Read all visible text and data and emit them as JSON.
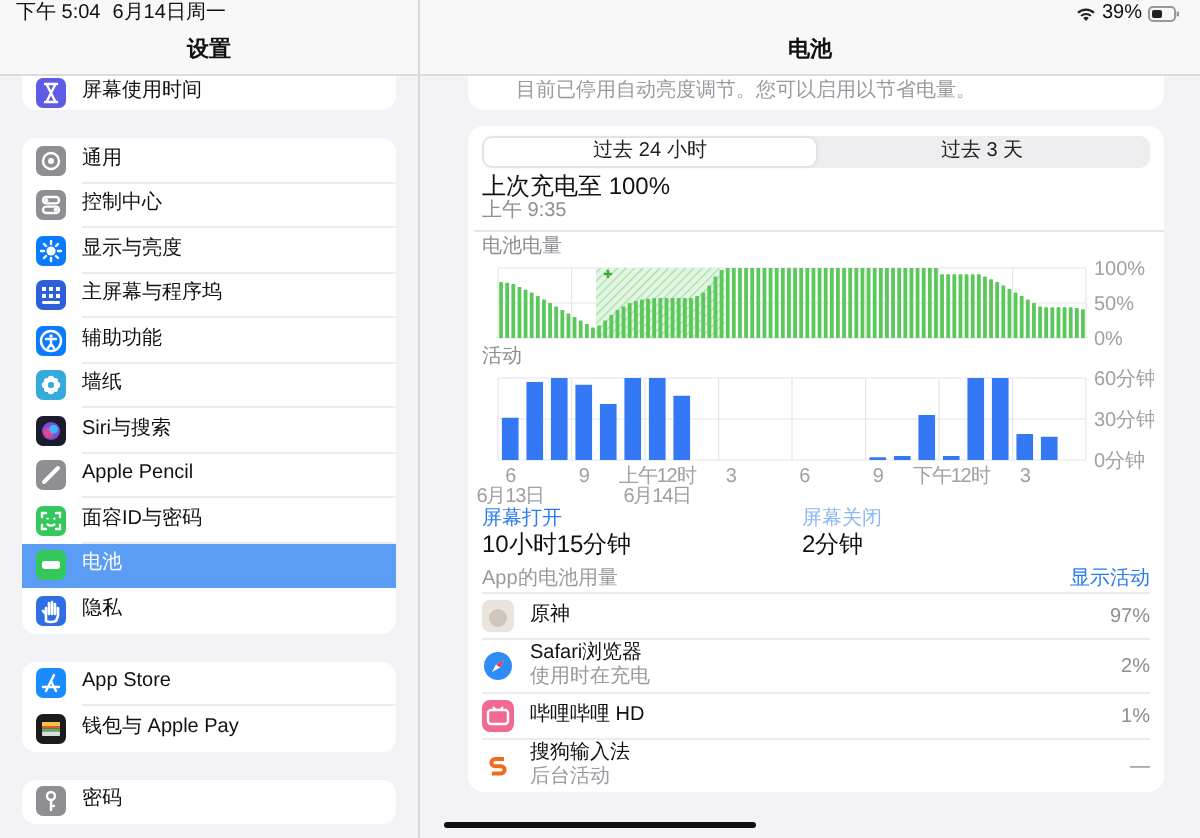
{
  "status_bar": {
    "time": "下午 5:04",
    "date": "6月14日周一",
    "battery": "39%"
  },
  "sidebar": {
    "title": "设置",
    "groups": [
      {
        "clipped": true,
        "items": [
          {
            "label": "屏幕使用时间",
            "selected": false
          }
        ]
      },
      {
        "clipped": false,
        "items": [
          {
            "label": "通用",
            "selected": false
          },
          {
            "label": "控制中心",
            "selected": false
          },
          {
            "label": "显示与亮度",
            "selected": false
          },
          {
            "label": "主屏幕与程序坞",
            "selected": false
          },
          {
            "label": "辅助功能",
            "selected": false
          },
          {
            "label": "墙纸",
            "selected": false
          },
          {
            "label": "Siri与搜索",
            "selected": false
          },
          {
            "label": "Apple Pencil",
            "selected": false
          },
          {
            "label": "面容ID与密码",
            "selected": false
          },
          {
            "label": "电池",
            "selected": true
          },
          {
            "label": "隐私",
            "selected": false
          }
        ]
      },
      {
        "clipped": false,
        "items": [
          {
            "label": "App Store",
            "selected": false
          },
          {
            "label": "钱包与 Apple Pay",
            "selected": false
          }
        ]
      },
      {
        "clipped": false,
        "items": [
          {
            "label": "密码",
            "selected": false
          }
        ]
      }
    ]
  },
  "detail": {
    "title": "电池",
    "notice": "目前已停用自动亮度调节。您可以启用以节省电量。",
    "segments": [
      {
        "label": "过去 24 小时",
        "selected": true
      },
      {
        "label": "过去 3 天",
        "selected": false
      }
    ],
    "last_charge": {
      "title": "上次充电至 100%",
      "time": "上午 9:35"
    },
    "battery_chart": {
      "chart_data": {
        "type": "bar",
        "title": "电池电量",
        "ylim": [
          0,
          100
        ],
        "yticks": [
          {
            "value": 0,
            "label": "0%"
          },
          {
            "value": 50,
            "label": "50%"
          },
          {
            "value": 100,
            "label": "100%"
          }
        ],
        "series": [
          {
            "color": "#5ac85a",
            "values": [
              80,
              79,
              77,
              73,
              69,
              65,
              60,
              55,
              50,
              45,
              40,
              35,
              30,
              25,
              20,
              15,
              18,
              25,
              33,
              40,
              45,
              50,
              53,
              55,
              56,
              57,
              57,
              57,
              57,
              57,
              57,
              57,
              60,
              65,
              75,
              88,
              97,
              100,
              100,
              100,
              100,
              100,
              100,
              100,
              100,
              100,
              100,
              100,
              100,
              100,
              100,
              100,
              100,
              100,
              100,
              100,
              100,
              100,
              100,
              100,
              100,
              100,
              100,
              100,
              100,
              100,
              100,
              100,
              100,
              100,
              100,
              100,
              91,
              91,
              91,
              91,
              91,
              91,
              91,
              88,
              84,
              80,
              75,
              70,
              65,
              60,
              55,
              50,
              45,
              44,
              44,
              44,
              44,
              44,
              43,
              41
            ]
          }
        ],
        "grid": true
      }
    },
    "activity_chart": {
      "chart_data": {
        "type": "bar",
        "title": "活动",
        "grid": true,
        "categories": [
          "6\n6月13日",
          null,
          null,
          "9",
          null,
          null,
          "上午12时\n6月14日",
          null,
          null,
          "3",
          null,
          null,
          "6",
          null,
          null,
          "9",
          null,
          null,
          "下午12时",
          null,
          null,
          "3",
          null,
          null
        ],
        "ylim": [
          0,
          60
        ],
        "yticks": [
          {
            "value": 0,
            "label": "0分钟"
          },
          {
            "value": 30,
            "label": "30分钟"
          },
          {
            "value": 60,
            "label": "60分钟"
          }
        ],
        "series": [
          {
            "color": "#3478f6",
            "values": [
              31,
              57,
              60,
              55,
              41,
              60,
              60,
              47,
              0,
              0,
              0,
              0,
              0,
              0,
              0,
              2,
              3,
              33,
              3,
              60,
              60,
              19,
              17,
              0
            ]
          }
        ]
      }
    },
    "screen_stats": [
      {
        "label": "屏幕打开",
        "value": "10小时15分钟",
        "selected": true
      },
      {
        "label": "屏幕关闭",
        "value": "2分钟",
        "selected": false
      }
    ],
    "app_usage": {
      "title": "App的电池用量",
      "action": "显示活动",
      "apps": [
        {
          "name": "原神",
          "percent": "97%"
        },
        {
          "name": "Safari浏览器",
          "subtitle": "使用时在充电",
          "percent": "2%"
        },
        {
          "name": "哔哩哔哩 HD",
          "percent": "1%"
        },
        {
          "name": "搜狗输入法",
          "subtitle": "后台活动",
          "percent": "—"
        }
      ]
    }
  }
}
